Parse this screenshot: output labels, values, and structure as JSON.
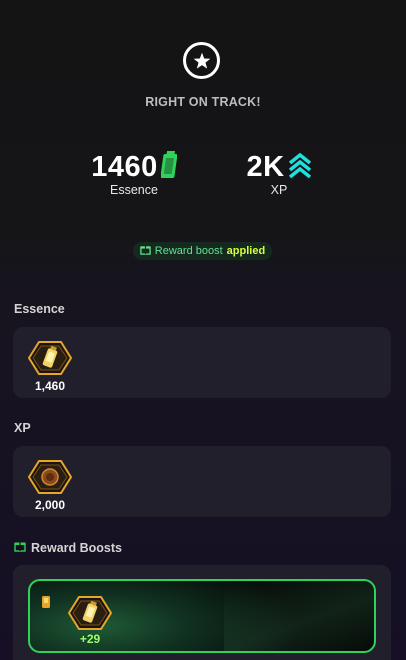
{
  "colors": {
    "accent_green": "#2fd35a",
    "xp_cyan": "#1fe0dc",
    "boost_text": "#5fe38f",
    "applied_text": "#d6ff3a",
    "card_bg": "#221f2d",
    "hex_gold": "#e6a62a"
  },
  "header": {
    "icon": "star-badge-icon",
    "headline": "RIGHT ON TRACK!"
  },
  "stats": {
    "essence": {
      "value": "1460",
      "label": "Essence",
      "icon": "essence-battery-icon"
    },
    "xp": {
      "value": "2K",
      "label": "XP",
      "icon": "xp-chevrons-icon"
    }
  },
  "boost_pill": {
    "icon": "gift-box-icon",
    "text": "Reward boost",
    "applied": "applied"
  },
  "sections": {
    "essence": {
      "title": "Essence",
      "item": {
        "icon": "essence-hex-icon",
        "quantity": "1,460"
      }
    },
    "xp": {
      "title": "XP",
      "item": {
        "icon": "xp-hex-icon",
        "quantity": "2,000"
      }
    },
    "reward_boosts": {
      "title": "Reward Boosts",
      "title_icon": "gift-box-icon",
      "item": {
        "icon": "essence-hex-icon",
        "small_icon": "gold-bar-icon",
        "amount": "+29"
      }
    }
  }
}
